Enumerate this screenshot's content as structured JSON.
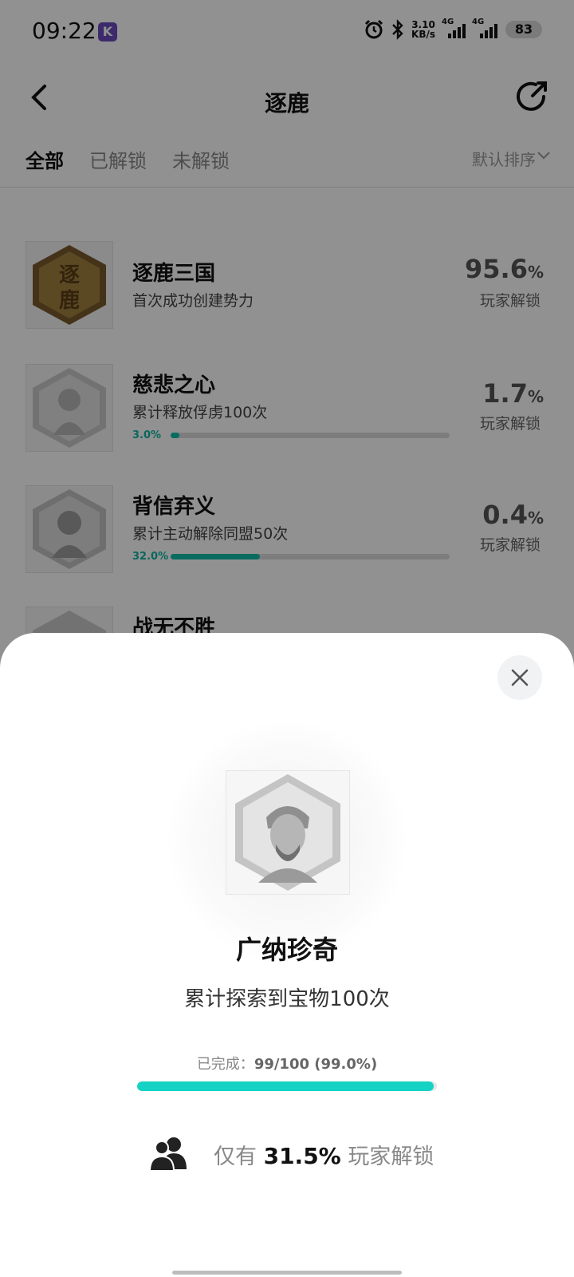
{
  "status_bar": {
    "time": "09:22",
    "app_badge": "K",
    "net_speed_value": "3.10",
    "net_speed_unit": "KB/s",
    "sig1": "4G",
    "sig2": "4G",
    "battery": "83"
  },
  "header": {
    "title": "逐鹿"
  },
  "tabs": [
    {
      "label": "全部"
    },
    {
      "label": "已解锁"
    },
    {
      "label": "未解锁"
    }
  ],
  "sort_label": "默认排序",
  "achievements": [
    {
      "title": "逐鹿三国",
      "desc": "首次成功创建势力",
      "rate": "95.6",
      "rate_unit": "%",
      "rate_label": "玩家解锁",
      "unlocked": true
    },
    {
      "title": "慈悲之心",
      "desc": "累计释放俘虏100次",
      "progress_pct": "3.0%",
      "progress": 0.03,
      "rate": "1.7",
      "rate_unit": "%",
      "rate_label": "玩家解锁",
      "unlocked": false
    },
    {
      "title": "背信弃义",
      "desc": "累计主动解除同盟50次",
      "progress_pct": "32.0%",
      "progress": 0.32,
      "rate": "0.4",
      "rate_unit": "%",
      "rate_label": "玩家解锁",
      "unlocked": false
    },
    {
      "title": "战无不胜",
      "unlocked": false
    }
  ],
  "badge_text": "逐鹿",
  "sheet": {
    "title": "广纳珍奇",
    "desc": "累计探索到宝物100次",
    "progress_prefix": "已完成：",
    "progress_text": "99/100 (99.0%)",
    "progress": 0.99,
    "unlock_prefix": "仅有",
    "unlock_rate": "31.5%",
    "unlock_suffix": "玩家解锁"
  },
  "colors": {
    "accent": "#14d3c4",
    "progress_teal": "#11bfa9",
    "gold_badge": "#8a6a34"
  },
  "icons": [
    "back-arrow-icon",
    "share-icon",
    "chevron-down-icon",
    "close-icon",
    "people-icon"
  ]
}
